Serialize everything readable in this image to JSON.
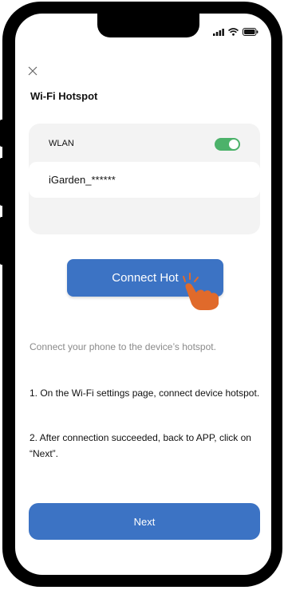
{
  "header": {
    "title": "Wi-Fi Hotspot"
  },
  "wifi_card": {
    "wlan_label": "WLAN",
    "wlan_enabled": true,
    "network_name": "iGarden_******"
  },
  "connect_button_label": "Connect Hot",
  "hint_text": "Connect your phone to the device’s hotspot.",
  "steps": [
    "1. On the Wi-Fi settings page, connect device hotspot.",
    "2. After connection succeeded, back to APP, click on “Next”."
  ],
  "next_button_label": "Next",
  "colors": {
    "primary": "#3c73c4",
    "toggle_on": "#4cb26a",
    "card_bg": "#f3f3f3",
    "hand": "#e06a2b"
  },
  "icons": {
    "close": "close-icon",
    "cellular": "signal-icon",
    "wifi": "wifi-icon",
    "battery": "battery-icon",
    "hand": "tap-hand-icon"
  }
}
